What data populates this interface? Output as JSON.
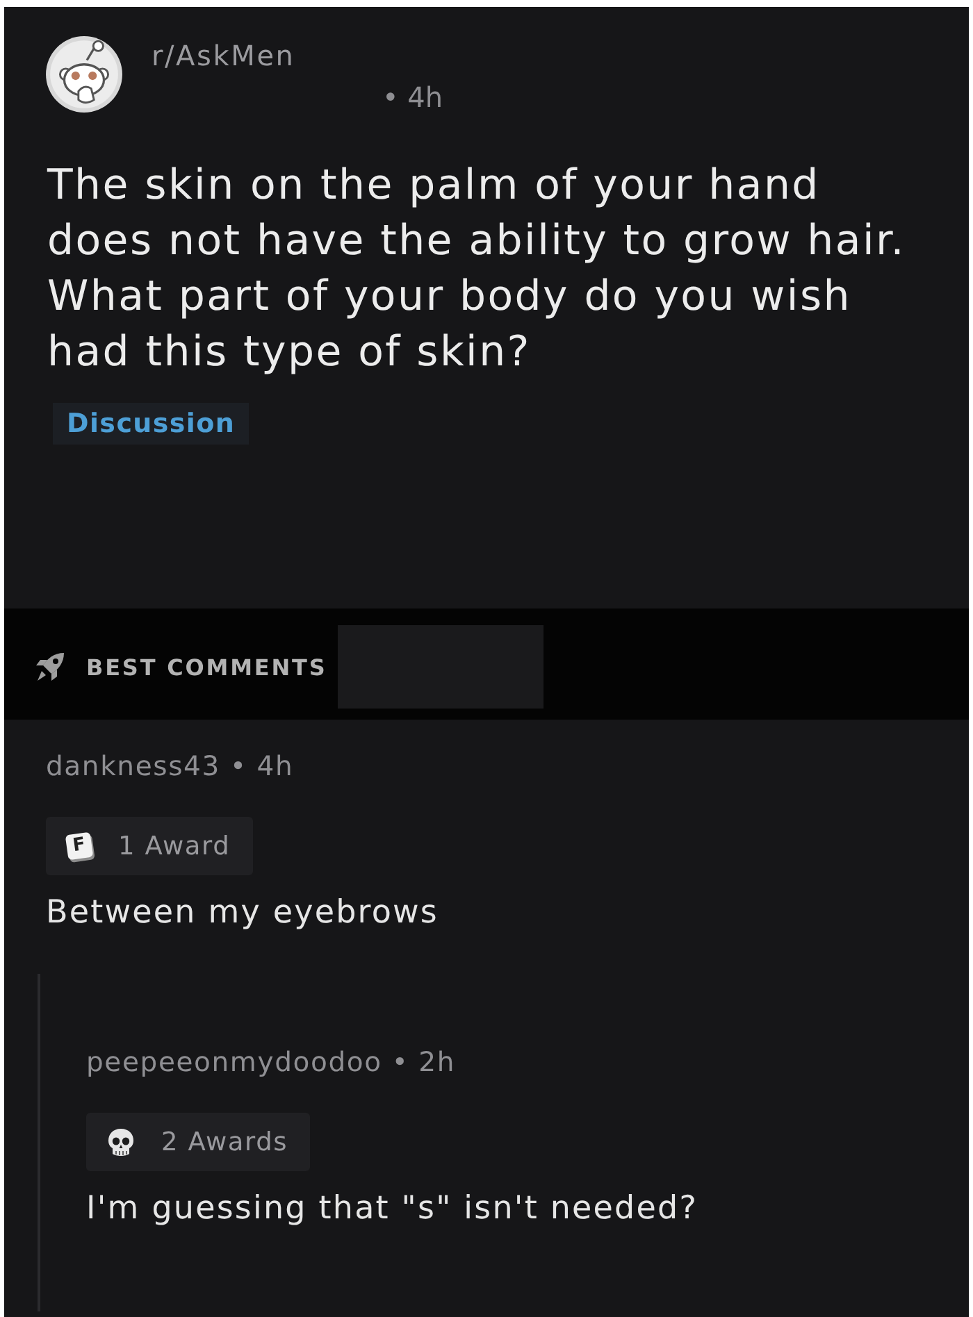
{
  "post": {
    "subreddit": "r/AskMen",
    "time": "• 4h",
    "title": "The skin on the palm of your hand does not have the ability to grow hair. What part of your body do you wish had this type of skin?",
    "flair": "Discussion"
  },
  "comments_header": {
    "label": "BEST COMMENTS"
  },
  "comments": [
    {
      "meta": "dankness43 • 4h",
      "award": {
        "kind": "keycap",
        "key_letter": "F",
        "label": "1 Award"
      },
      "body": "Between my eyebrows",
      "replies": [
        {
          "meta": "peepeeonmydoodoo • 2h",
          "award": {
            "kind": "skull",
            "label": "2 Awards"
          },
          "body": "I'm guessing that \"s\" isn't needed?"
        }
      ]
    }
  ]
}
